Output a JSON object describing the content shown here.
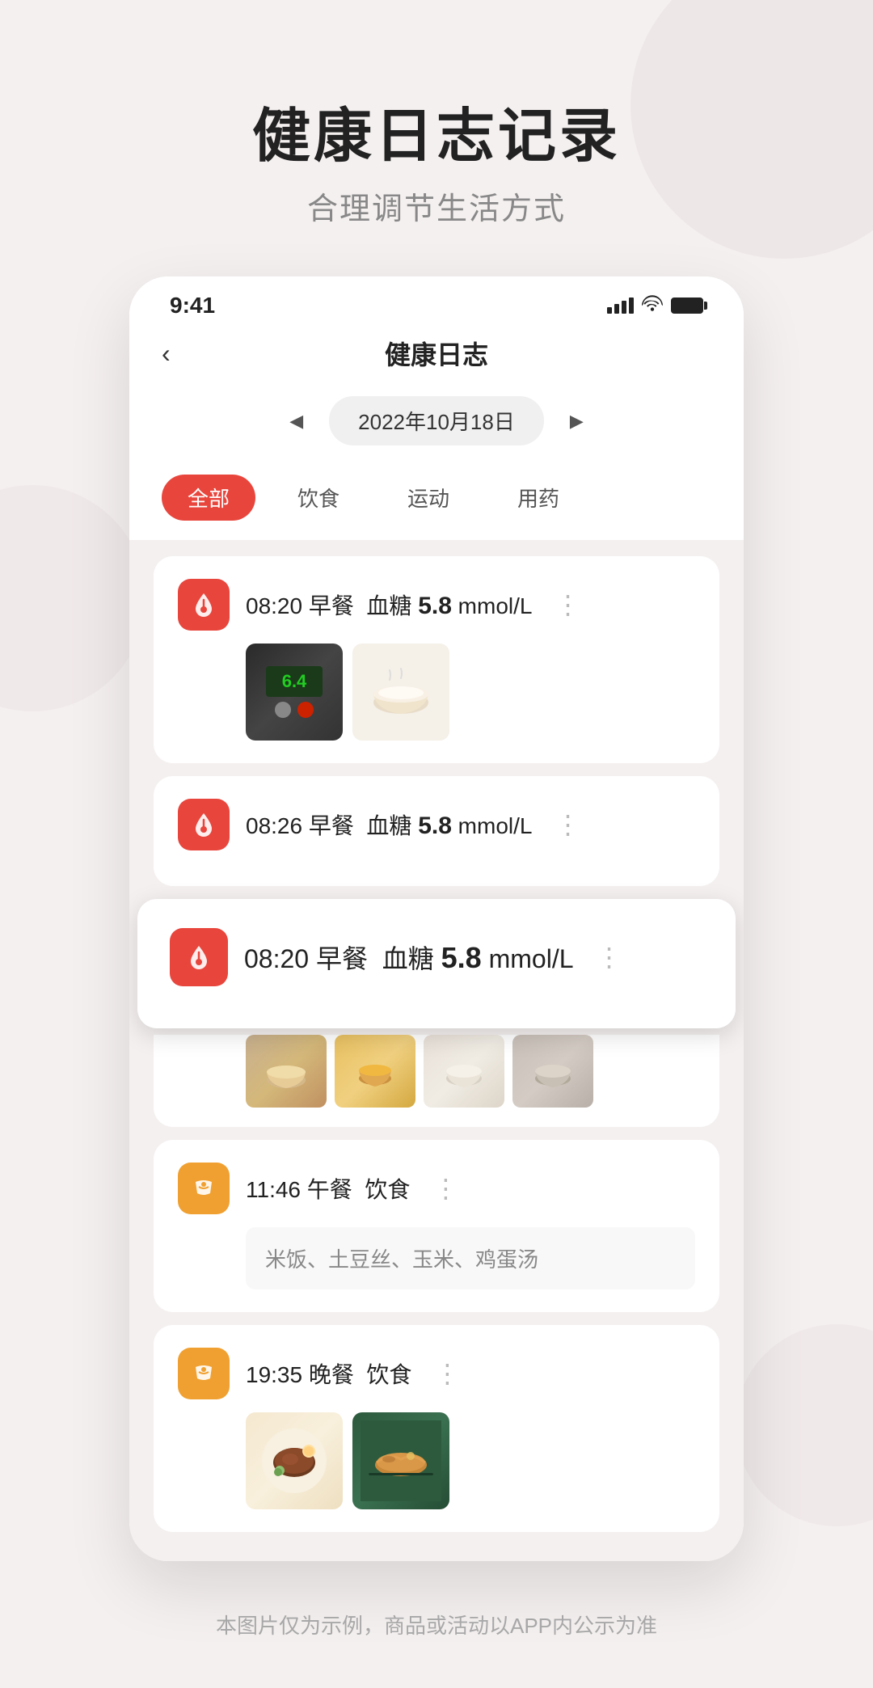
{
  "page": {
    "bg_title": "健康日志记录",
    "bg_subtitle": "合理调节生活方式",
    "footer": "本图片仅为示例，商品或活动以APP内公示为准"
  },
  "statusBar": {
    "time": "9:41"
  },
  "navBar": {
    "title": "健康日志",
    "back_label": "‹"
  },
  "dateSelector": {
    "date": "2022年10月18日",
    "prev_arrow": "◀",
    "next_arrow": "▶"
  },
  "filterTabs": [
    {
      "label": "全部",
      "active": true
    },
    {
      "label": "饮食",
      "active": false
    },
    {
      "label": "运动",
      "active": false
    },
    {
      "label": "用药",
      "active": false
    }
  ],
  "logEntries": [
    {
      "id": "entry1",
      "time": "08:20",
      "category": "早餐",
      "type": "blood_sugar",
      "label": "血糖",
      "value": "5.8",
      "unit": "mmol/L",
      "hasImages": true
    },
    {
      "id": "entry2",
      "time": "08:26",
      "category": "早餐",
      "type": "blood_sugar",
      "label": "血糖",
      "value": "5.8",
      "unit": "mmol/L",
      "hasImages": false
    },
    {
      "id": "entry3_highlight",
      "time": "08:20",
      "category": "早餐",
      "type": "blood_sugar",
      "label": "血糖",
      "value": "5.8",
      "unit": "mmol/L",
      "hasImages": false,
      "highlighted": true
    },
    {
      "id": "entry4",
      "time": "11:46",
      "category": "午餐",
      "type": "food",
      "label": "饮食",
      "text": "米饭、土豆丝、玉米、鸡蛋汤",
      "hasImages": false,
      "hasText": true
    },
    {
      "id": "entry5",
      "time": "19:35",
      "category": "晚餐",
      "type": "food",
      "label": "饮食",
      "hasImages": true,
      "hasLargeImages": true
    }
  ]
}
